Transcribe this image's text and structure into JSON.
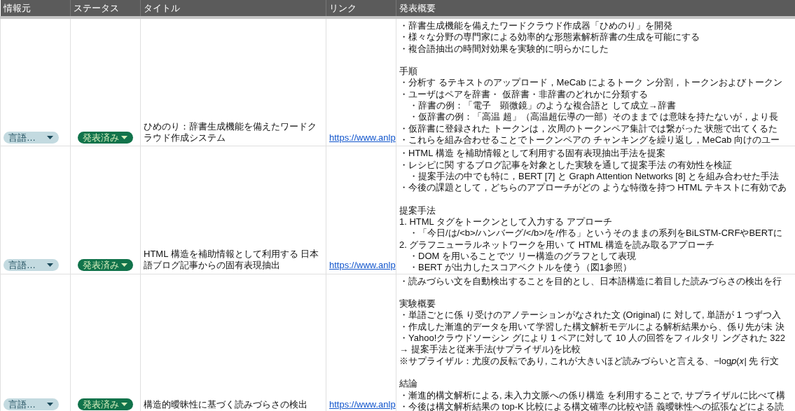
{
  "columns": [
    "情報元",
    "ステータス",
    "タイトル",
    "リンク",
    "発表概要"
  ],
  "rows": [
    {
      "source": "言語…",
      "status": "発表済み",
      "title": "ひめのり：辞書生成機能を備えたワードクラウド作成システム",
      "link": "https://www.anlp",
      "summary": [
        [
          {
            "kind": "line",
            "text": "・辞書生成機能を備えたワードクラウド作成器「ひめのり」を開発"
          },
          {
            "kind": "line",
            "text": "・様々な分野の専門家による効率的な形態素解析辞書の生成を可能にする"
          },
          {
            "kind": "line",
            "text": "・複合語抽出の時間対効果を実験的に明らかにした"
          }
        ],
        [
          {
            "kind": "line",
            "text": "手順"
          },
          {
            "kind": "line",
            "text": "・分析す るテキストのアップロード，MeCab によるトーク ン分割，トークンおよびトークン"
          },
          {
            "kind": "line",
            "text": "・ユーザはペアを辞書・ 仮辞書・非辞書のどれかに分類する"
          },
          {
            "kind": "sub",
            "text": "・辞書の例：「電子　顕微鏡」のような複合語と して成立→辞書"
          },
          {
            "kind": "sub",
            "text": "・仮辞書の例：「高温 超」（高温超伝導の一部）そのままで は意味を持たないが，より長"
          },
          {
            "kind": "line",
            "text": "・仮辞書に登録された トークンは，次周のトークンペア集計では繋がった 状態で出てくるた"
          },
          {
            "kind": "line",
            "text": "・これらを組み合わせることでトークンペアの チャンキングを繰り返し，MeCab 向けのユー"
          }
        ]
      ]
    },
    {
      "source": "言語…",
      "status": "発表済み",
      "title": "HTML 構造を補助情報として利用する 日本語ブログ記事からの固有表現抽出",
      "link": "https://www.anlp",
      "summary": [
        [
          {
            "kind": "line",
            "text": "・HTML 構造 を補助情報として利用する固有表現抽出手法を提案"
          },
          {
            "kind": "line",
            "text": "・レシピに関 するブログ記事を対象とした実験を通して提案手法 の有効性を検証"
          },
          {
            "kind": "sub",
            "text": "・提案手法の中でも特に，BERT [7] と Graph Attention Networks [8] とを組み合わせた手法"
          },
          {
            "kind": "line",
            "text": "・今後の課題として，どちらのアプローチがどの ような特徴を持つ HTML テキストに有効であ"
          }
        ],
        [
          {
            "kind": "line",
            "text": "提案手法"
          },
          {
            "kind": "line",
            "text": "1. HTML タグをトークンとして入力する アプローチ"
          },
          {
            "kind": "sub",
            "text": "・「今日/は/<b>/ハンバーグ/</b>/を/作る」というそのままの系列をBiLSTM-CRFやBERTに"
          },
          {
            "kind": "line",
            "text": "2. グラフニューラルネットワークを用い て HTML 構造を読み取るアプローチ"
          },
          {
            "kind": "sub",
            "text": "・DOM を用いることでツ リー構造のグラフとして表現"
          },
          {
            "kind": "sub",
            "text": "・BERT が出力したスコアベクトルを使う（図1参照）"
          }
        ]
      ]
    },
    {
      "source": "言語…",
      "status": "発表済み",
      "title": "構造的曖昧性に基づく読みづらさの検出",
      "link": "https://www.anlp",
      "summary": [
        [
          {
            "kind": "line",
            "text": "・読みづらい文を自動検出することを目的とし、日本語構造に着目した読みづらさの検出を行"
          }
        ],
        [
          {
            "kind": "line",
            "text": "実験概要"
          },
          {
            "kind": "line",
            "text": "・単語ごとに係 り受けのアノテーションがなされた文 (Original) に 対して, 単語が 1 つずつ入"
          },
          {
            "kind": "line",
            "text": "・作成した漸進的データを用いて学習した構文解析モデルによる解析結果から、係り先が未 決"
          },
          {
            "kind": "line",
            "text": "・Yahoo!クラウドソーシン グにより 1 ペアに対して 10 人の回答をフィルタリ ングされた 322"
          },
          {
            "kind": "line",
            "text": "→ 提案手法と従来手法(サプライザル)を比較"
          },
          {
            "kind": "line",
            "text": "※サプライザル：尤度の反転であり, これが大きいほど読みづらいと言える、−log𝑝(𝑥| 先 行文"
          }
        ],
        [
          {
            "kind": "line",
            "text": "結論"
          },
          {
            "kind": "line",
            "text": "・漸進的構文解析による, 未入力文脈への係り構造 を利用することで, サプライザルに比べて構"
          },
          {
            "kind": "line",
            "text": "・今後は構文解析結果の top-K 比較による構文確率の比較や語 義曖昧性への拡張などによる読"
          }
        ]
      ]
    }
  ]
}
